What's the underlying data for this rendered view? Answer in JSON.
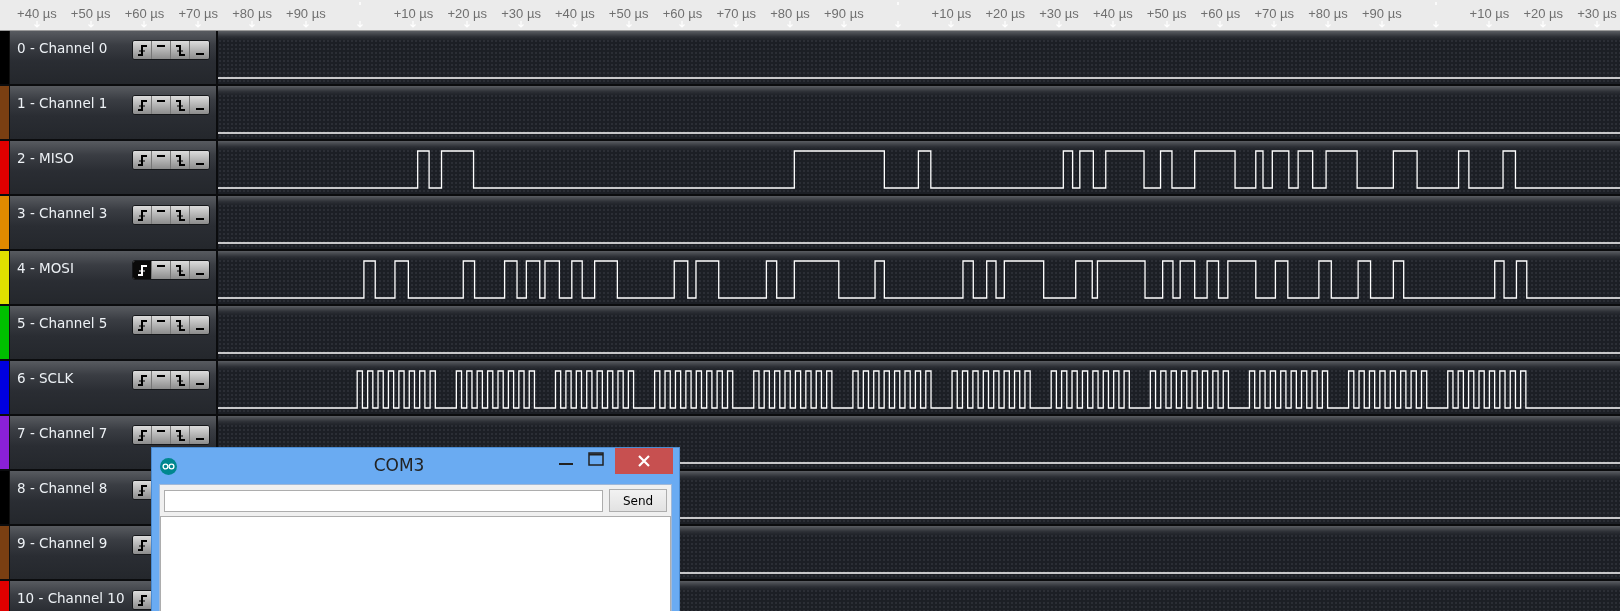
{
  "ruler": {
    "ticks": [
      {
        "kind": "label",
        "label": "+40 µs"
      },
      {
        "kind": "label",
        "label": "+50 µs"
      },
      {
        "kind": "label",
        "label": "+60 µs"
      },
      {
        "kind": "label",
        "label": "+70 µs"
      },
      {
        "kind": "label",
        "label": "+80 µs"
      },
      {
        "kind": "label",
        "label": "+90 µs"
      },
      {
        "kind": "origin"
      },
      {
        "kind": "label",
        "label": "+10 µs"
      },
      {
        "kind": "label",
        "label": "+20 µs"
      },
      {
        "kind": "label",
        "label": "+30 µs"
      },
      {
        "kind": "label",
        "label": "+40 µs"
      },
      {
        "kind": "label",
        "label": "+50 µs"
      },
      {
        "kind": "label",
        "label": "+60 µs"
      },
      {
        "kind": "label",
        "label": "+70 µs"
      },
      {
        "kind": "label",
        "label": "+80 µs"
      },
      {
        "kind": "label",
        "label": "+90 µs"
      },
      {
        "kind": "origin"
      },
      {
        "kind": "label",
        "label": "+10 µs"
      },
      {
        "kind": "label",
        "label": "+20 µs"
      },
      {
        "kind": "label",
        "label": "+30 µs"
      },
      {
        "kind": "label",
        "label": "+40 µs"
      },
      {
        "kind": "label",
        "label": "+50 µs"
      },
      {
        "kind": "label",
        "label": "+60 µs"
      },
      {
        "kind": "label",
        "label": "+70 µs"
      },
      {
        "kind": "label",
        "label": "+80 µs"
      },
      {
        "kind": "label",
        "label": "+90 µs"
      },
      {
        "kind": "origin"
      },
      {
        "kind": "label",
        "label": "+10 µs"
      },
      {
        "kind": "label",
        "label": "+20 µs"
      },
      {
        "kind": "label",
        "label": "+30 µs"
      }
    ]
  },
  "channels": [
    {
      "name": "0 - Channel 0",
      "color": "#000000",
      "kind": "idle",
      "triggers": [
        {
          "kind": "rising",
          "selected": false
        },
        {
          "kind": "high",
          "selected": false
        },
        {
          "kind": "falling",
          "selected": false
        },
        {
          "kind": "low",
          "selected": false
        }
      ]
    },
    {
      "name": "1 - Channel 1",
      "color": "#7a3f12",
      "kind": "idle",
      "triggers": [
        {
          "kind": "rising",
          "selected": false
        },
        {
          "kind": "high",
          "selected": false
        },
        {
          "kind": "falling",
          "selected": false
        },
        {
          "kind": "low",
          "selected": false
        }
      ]
    },
    {
      "name": "2 - MISO",
      "color": "#e00000",
      "kind": "data",
      "triggers": [
        {
          "kind": "rising",
          "selected": false
        },
        {
          "kind": "high",
          "selected": false
        },
        {
          "kind": "falling",
          "selected": false
        },
        {
          "kind": "low",
          "selected": false
        }
      ]
    },
    {
      "name": "3 - Channel 3",
      "color": "#e08a00",
      "kind": "idle",
      "triggers": [
        {
          "kind": "rising",
          "selected": false
        },
        {
          "kind": "high",
          "selected": false
        },
        {
          "kind": "falling",
          "selected": false
        },
        {
          "kind": "low",
          "selected": false
        }
      ]
    },
    {
      "name": "4 - MOSI",
      "color": "#e0e000",
      "kind": "data",
      "triggers": [
        {
          "kind": "rising",
          "selected": true
        },
        {
          "kind": "high",
          "selected": false
        },
        {
          "kind": "falling",
          "selected": false
        },
        {
          "kind": "low",
          "selected": false
        }
      ]
    },
    {
      "name": "5 - Channel 5",
      "color": "#00c000",
      "kind": "idle",
      "triggers": [
        {
          "kind": "rising",
          "selected": false
        },
        {
          "kind": "high",
          "selected": false
        },
        {
          "kind": "falling",
          "selected": false
        },
        {
          "kind": "low",
          "selected": false
        }
      ]
    },
    {
      "name": "6 - SCLK",
      "color": "#0000e0",
      "kind": "clock",
      "triggers": [
        {
          "kind": "rising",
          "selected": false
        },
        {
          "kind": "high",
          "selected": false
        },
        {
          "kind": "falling",
          "selected": false
        },
        {
          "kind": "low",
          "selected": false
        }
      ]
    },
    {
      "name": "7 - Channel 7",
      "color": "#8a20d8",
      "kind": "idle",
      "triggers": [
        {
          "kind": "rising",
          "selected": false
        },
        {
          "kind": "high",
          "selected": false
        },
        {
          "kind": "falling",
          "selected": false
        },
        {
          "kind": "low",
          "selected": false
        }
      ]
    },
    {
      "name": "8 - Channel 8",
      "color": "#000000",
      "kind": "idle",
      "triggers": [
        {
          "kind": "rising"
        }
      ]
    },
    {
      "name": "9 - Channel 9",
      "color": "#7a3f12",
      "kind": "idle",
      "triggers": [
        {
          "kind": "rising"
        }
      ]
    },
    {
      "name": "10 - Channel 10",
      "color": "#e00000",
      "kind": "idle",
      "triggers": [
        {
          "kind": "rising"
        }
      ]
    }
  ],
  "serial_monitor": {
    "title": "COM3",
    "send_button": "Send"
  }
}
